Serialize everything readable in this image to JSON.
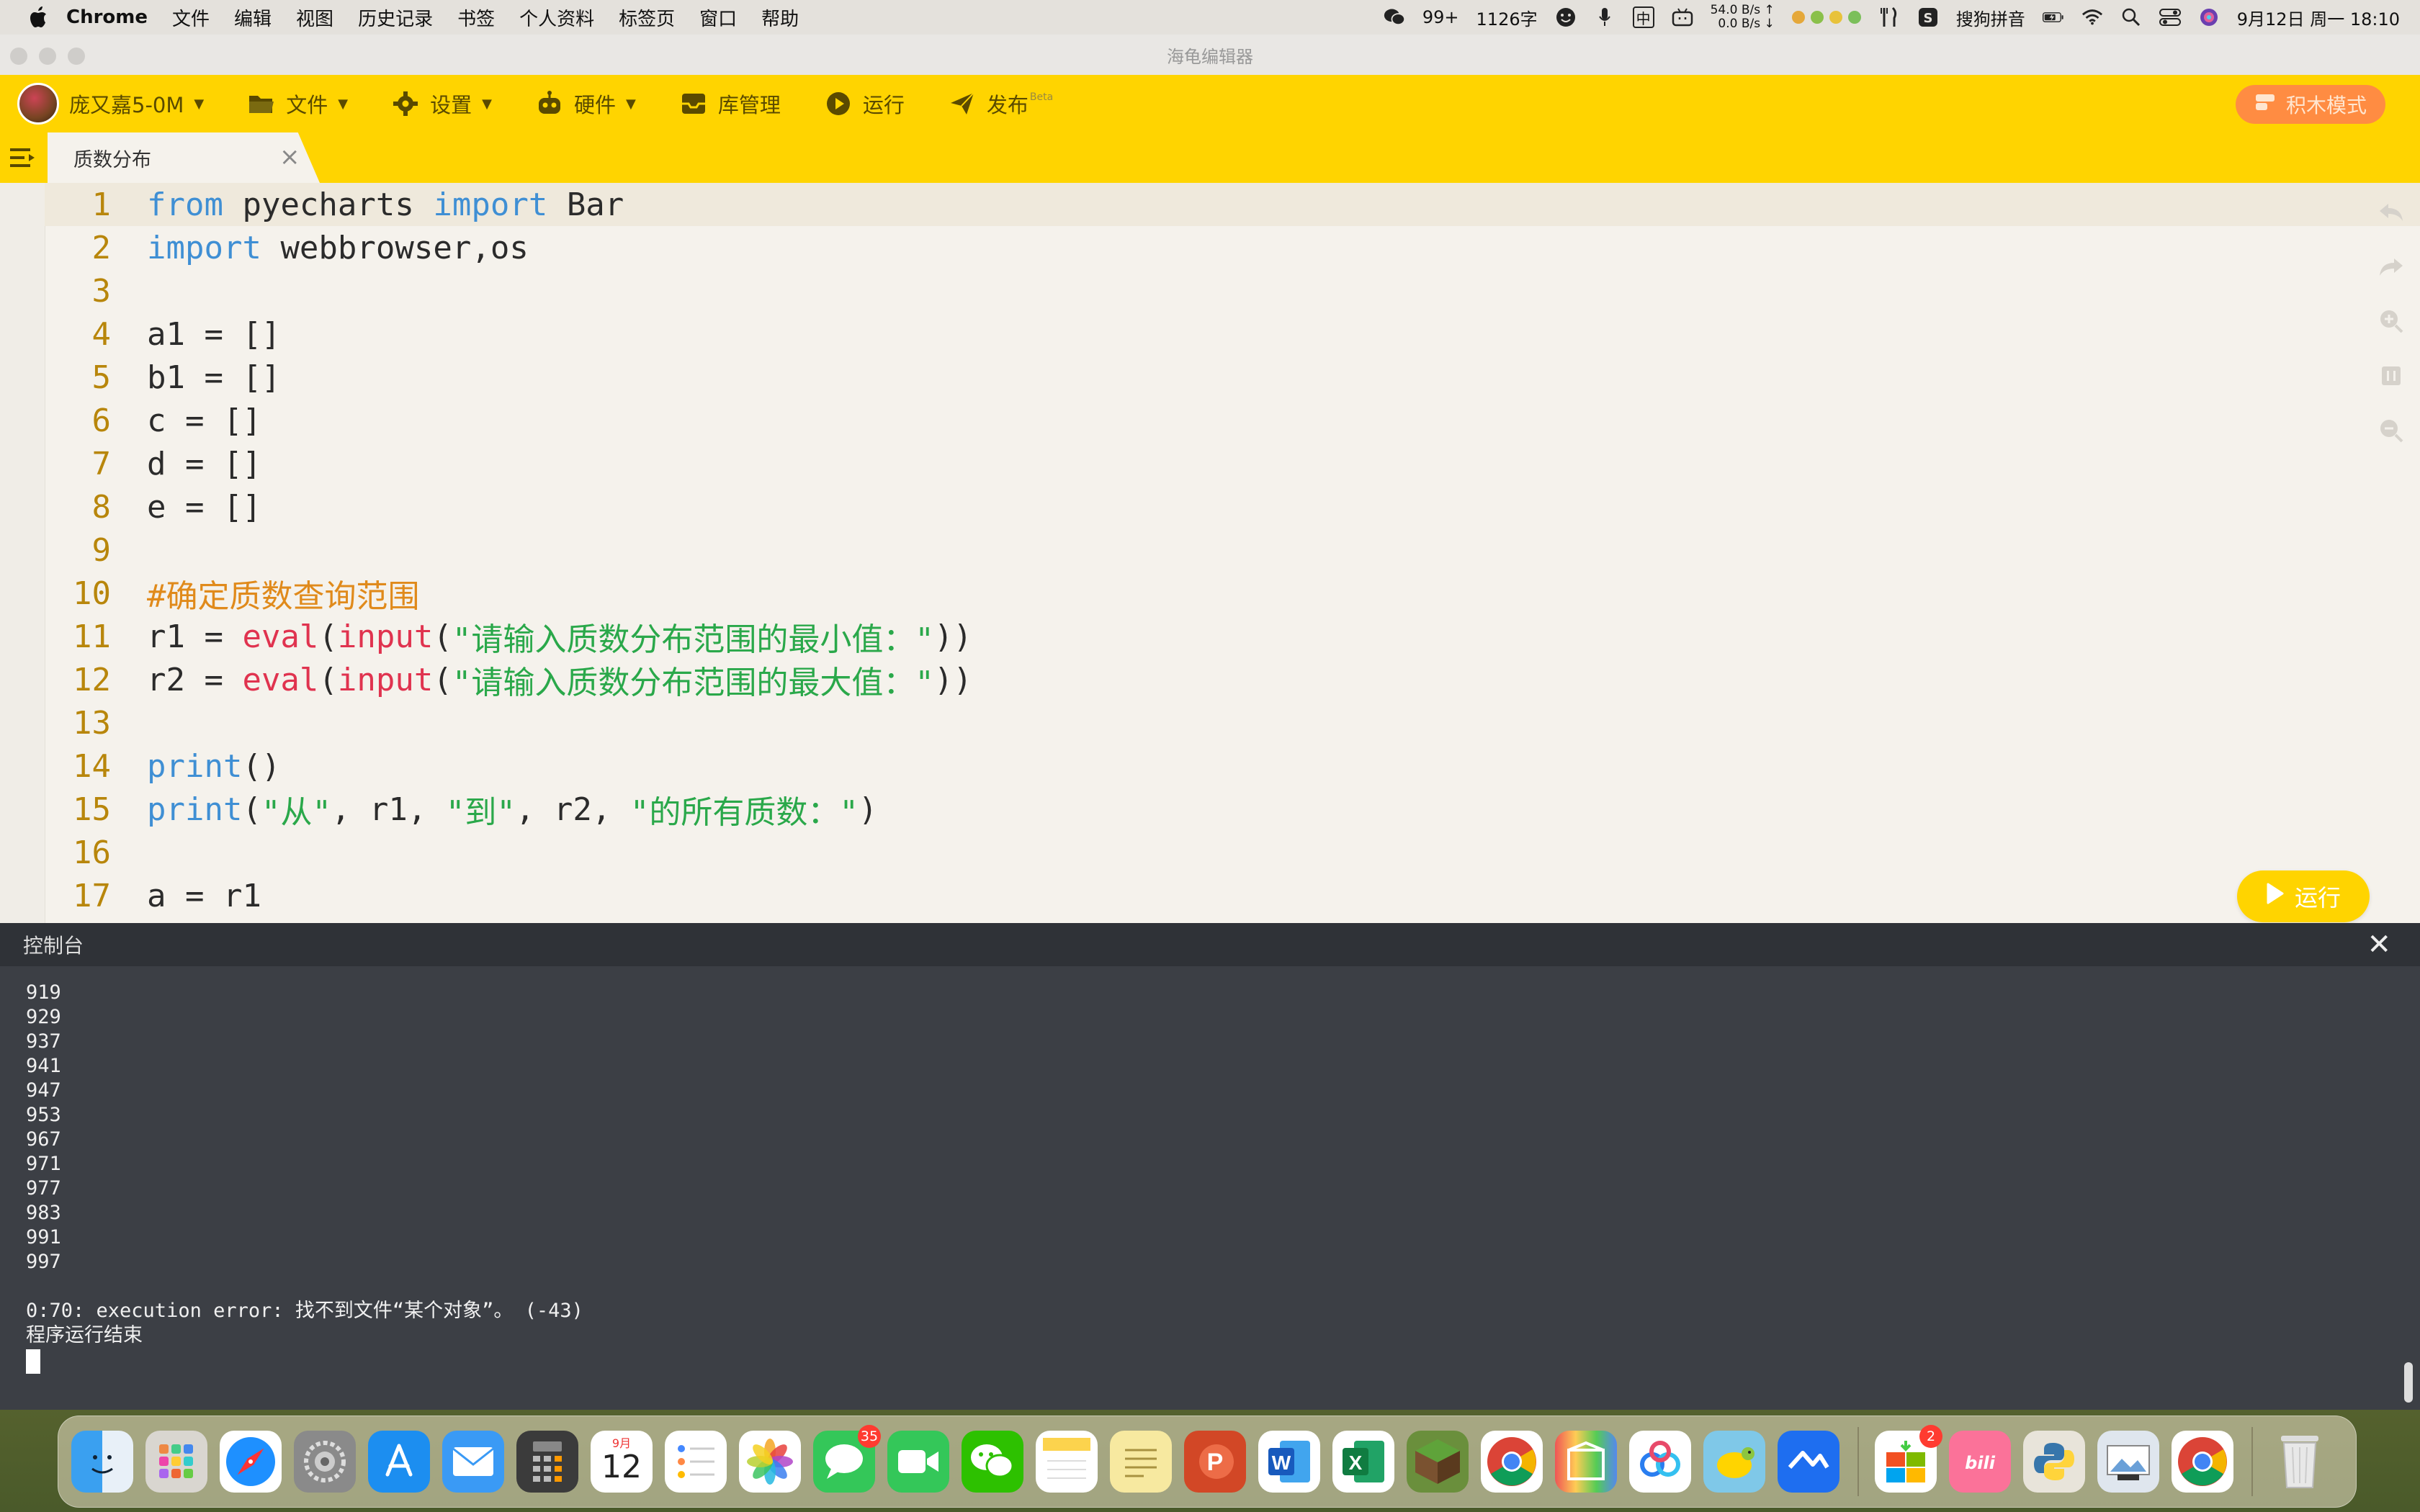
{
  "menubar": {
    "app_name": "Chrome",
    "items": [
      "文件",
      "编辑",
      "视图",
      "历史记录",
      "书签",
      "个人资料",
      "标签页",
      "窗口",
      "帮助"
    ],
    "wechat_count": "99+",
    "char_count": "1126字",
    "ime_char": "中",
    "net_up": "54.0 B/s ↑",
    "net_down": "0.0 B/s ↓",
    "input_method": "搜狗拼音",
    "datetime": "9月12日 周一  18:10"
  },
  "window": {
    "title": "海龟编辑器"
  },
  "toolbar": {
    "user_name": "庞又嘉5-0M",
    "file": "文件",
    "settings": "设置",
    "hardware": "硬件",
    "library": "库管理",
    "run": "运行",
    "publish": "发布",
    "publish_badge": "Beta",
    "block_mode": "积木模式"
  },
  "tab": {
    "label": "质数分布",
    "close": "×"
  },
  "editor": {
    "run_button": "运行",
    "line_numbers": [
      "1",
      "2",
      "3",
      "4",
      "5",
      "6",
      "7",
      "8",
      "9",
      "10",
      "11",
      "12",
      "13",
      "14",
      "15",
      "16",
      "17"
    ],
    "lines": {
      "l1": {
        "kw1": "from",
        "t1": " pyecharts ",
        "kw2": "import",
        "t2": " Bar"
      },
      "l2": {
        "kw1": "import",
        "t1": " webbrowser,os"
      },
      "l4": "a1 = []",
      "l5": "b1 = []",
      "l6": "c = []",
      "l7": "d = []",
      "l8": "e = []",
      "l10": "#确定质数查询范围",
      "l11": {
        "t1": "r1 = ",
        "fn1": "eval",
        "t2": "(",
        "fn2": "input",
        "t3": "(",
        "s1": "\"请输入质数分布范围的最小值：\"",
        "t4": "))"
      },
      "l12": {
        "t1": "r2 = ",
        "fn1": "eval",
        "t2": "(",
        "fn2": "input",
        "t3": "(",
        "s1": "\"请输入质数分布范围的最大值：\"",
        "t4": "))"
      },
      "l14": {
        "kw1": "print",
        "t1": "()"
      },
      "l15": {
        "kw1": "print",
        "t1": "(",
        "s1": "\"从\"",
        "t2": ", r1, ",
        "s2": "\"到\"",
        "t3": ", r2, ",
        "s3": "\"的所有质数：\"",
        "t4": ")"
      },
      "l17": "a = r1"
    }
  },
  "console": {
    "title": "控制台",
    "close": "✕",
    "output": [
      "919",
      "929",
      "937",
      "941",
      "947",
      "953",
      "967",
      "971",
      "977",
      "983",
      "991",
      "997"
    ],
    "error": "0:70: execution error: 找不到文件“某个对象”。 (-43)",
    "end_message": "程序运行结束"
  },
  "dock": {
    "messages_badge": "35",
    "appstore_badge": "2",
    "calendar_month": "9月",
    "calendar_day": "12"
  }
}
